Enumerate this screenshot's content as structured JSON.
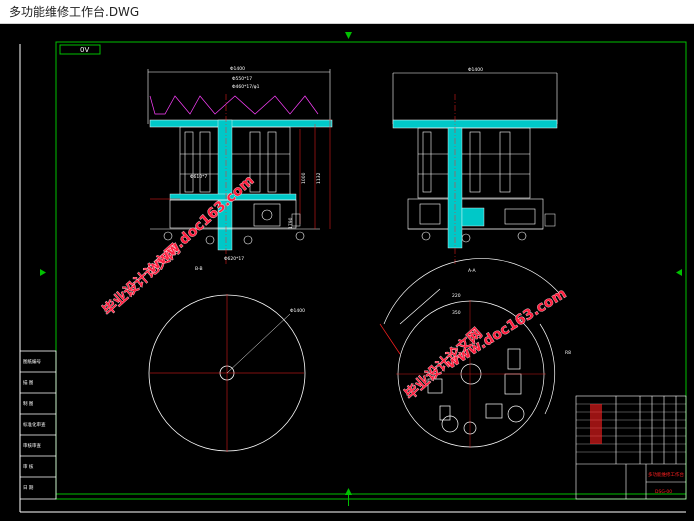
{
  "window": {
    "title": "多功能维修工作台.DWG"
  },
  "drawing": {
    "tag_left": "0V",
    "dims": {
      "front_width": "Φ1400",
      "side_width": "Φ1400",
      "d1": "Φ550*17",
      "d2": "Φ460*17/φ1",
      "d3": "Φ610*7",
      "d4": "Φ620*17",
      "d5": "1000",
      "d6": "1132",
      "d7": "1790",
      "section_front": "B-B",
      "section_side": "A-A",
      "circle_dim": "Φ1400",
      "pad_a": "220",
      "pad_b": "350",
      "arc_r": "R8"
    },
    "watermarks": [
      "毕业设计论文网",
      "www.doc163.com"
    ],
    "titleblock": {
      "company": "多功能维修工作台",
      "code": "DSG-00"
    },
    "side_table_rows": [
      "图纸编号",
      "描 图",
      "制 图",
      "标准化审查",
      "审核审查",
      "审 核",
      "日 期"
    ],
    "colors": {
      "background": "#000000",
      "frame_green": "#00c000",
      "frame_white": "#ffffff",
      "red": "#ff2020",
      "cyan": "#00e0e0",
      "magenta": "#ff40ff",
      "yellow": "#ffff00"
    }
  }
}
